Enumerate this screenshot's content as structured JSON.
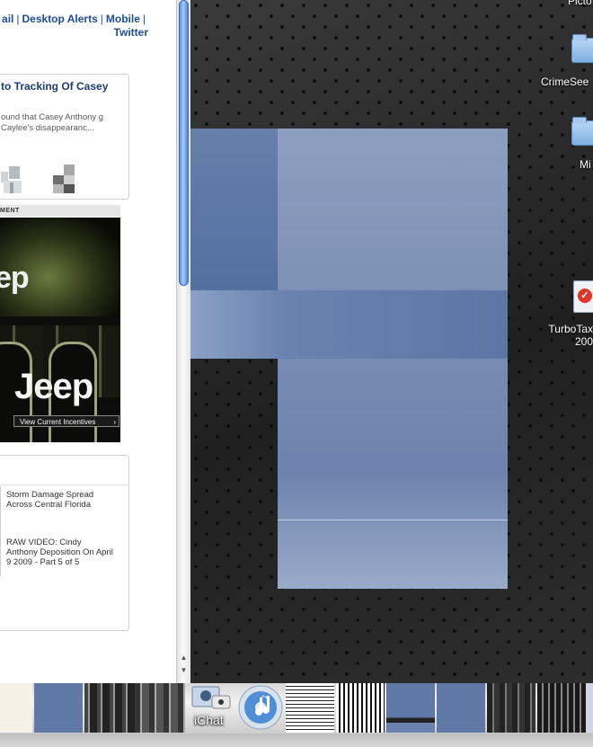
{
  "browser": {
    "top_links": [
      "ail",
      "Desktop Alerts",
      "Mobile",
      "Twitter"
    ],
    "story": {
      "title": "to Tracking Of Casey",
      "text": "ound that Casey Anthony g Caylee's disappearanc..."
    },
    "ad": {
      "label": "MENT",
      "logo_top": "ep",
      "logo_main": "Jeep",
      "cta": "View Current Incentives",
      "cta_arrow": "›"
    },
    "related": [
      "Storm Damage Spread Across Central Florida",
      "RAW VIDEO: Cindy Anthony Deposition On April 9 2009 - Part 5 of 5"
    ]
  },
  "desktop": {
    "icons": [
      {
        "label": "Picto",
        "icon": "folder-icon"
      },
      {
        "label": "CrimeSee",
        "icon": "folder-icon"
      },
      {
        "label": "Mi",
        "icon": "folder-icon"
      },
      {
        "label": "TurboTax 200",
        "icon": "turbotax-icon"
      }
    ]
  },
  "dock": {
    "ichat_label": "iChat",
    "items": [
      "ichat-icon",
      "itunes-icon"
    ]
  },
  "colors": {
    "link": "#1b4f9c",
    "window_blue": "#7b8fb4",
    "scroll_thumb": "#5a8ed8"
  }
}
